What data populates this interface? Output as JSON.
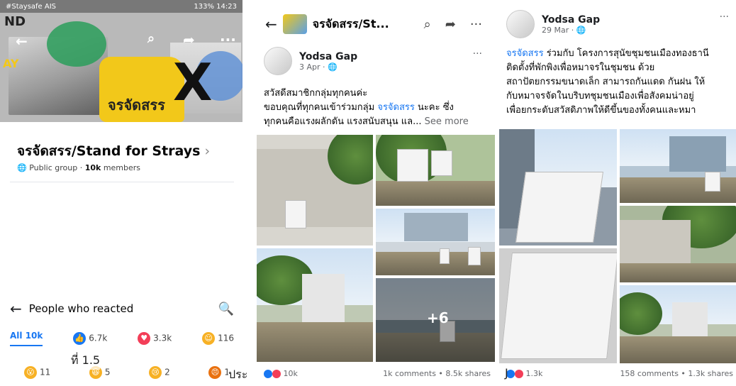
{
  "panel1": {
    "status": {
      "left": "#Staysafe AIS",
      "right": "133% 14:23"
    },
    "cover_text": {
      "nd": "ND",
      "ay": "AY",
      "brand": "จรจัดสรร",
      "x": "X"
    },
    "group": {
      "title": "จรจัดสรร/Stand for Strays",
      "privacy": "Public group",
      "members": "10k",
      "members_label": "members"
    },
    "reactions_header": {
      "title": "People who reacted"
    },
    "tabs": [
      {
        "label": "All 10k"
      },
      {
        "icon": "like-icon",
        "count": "6.7k",
        "color": "#1877f2"
      },
      {
        "icon": "love-icon",
        "count": "3.3k",
        "color": "#f33e58"
      },
      {
        "icon": "care-icon",
        "count": "116",
        "color": "#f7b125"
      }
    ],
    "tabs2": [
      {
        "icon": "wow-icon",
        "count": "11",
        "color": "#f7b125"
      },
      {
        "icon": "haha-icon",
        "count": "5",
        "color": "#f7b125"
      },
      {
        "icon": "sad-icon",
        "count": "2",
        "color": "#f7b125"
      },
      {
        "icon": "angry-icon",
        "count": "1",
        "color": "#e9710f"
      }
    ]
  },
  "panel2": {
    "header": {
      "title": "จรจัดสรร/St..."
    },
    "post": {
      "name": "Yodsa Gap",
      "date": "3 Apr · 🌐",
      "line1": "สวัสดีสมาชิกกลุ่มทุกคนค่ะ",
      "line2a": "ขอบคุณที่ทุกคนเข้าร่วมกลุ่ม ",
      "tag": "จรจัดสรร",
      "line2b": " นะคะ ซึ่ง",
      "line3": "ทุกคนคือแรงผลักดัน แรงสนับสนุน แล...",
      "see_more": " See more"
    },
    "plus": "+6",
    "footer": {
      "reactions": "10k",
      "stats": "1k comments • 8.5k shares"
    }
  },
  "panel3": {
    "post": {
      "name": "Yodsa Gap",
      "date": "29 Mar · 🌐",
      "tag": "จรจัดสรร",
      "line1": " ร่วมกับ โครงการสุนัขชุมชนเมืองทองธานี",
      "line2": "ติดตั้งที่พักพิงเพื่อหมาจรในชุมชน ด้วย",
      "line3": "สถาปัตยกรรมขนาดเล็ก สามารถกันแดด กันฝน ให้",
      "line4": "กับหมาจรจัดในบริบทชุมชนเมืองเพื่อสังคมน่าอยู่",
      "line5": "เพื่อยกระดับสวัสดิภาพให้ดีขึ้นของทั้งคนและหมา"
    },
    "footer": {
      "reactions": "1.3k",
      "stats": "158 comments • 1.3k shares"
    }
  },
  "captions": {
    "c1": "ที่ 1.5",
    "c2": "ประ",
    "c3": "J"
  }
}
